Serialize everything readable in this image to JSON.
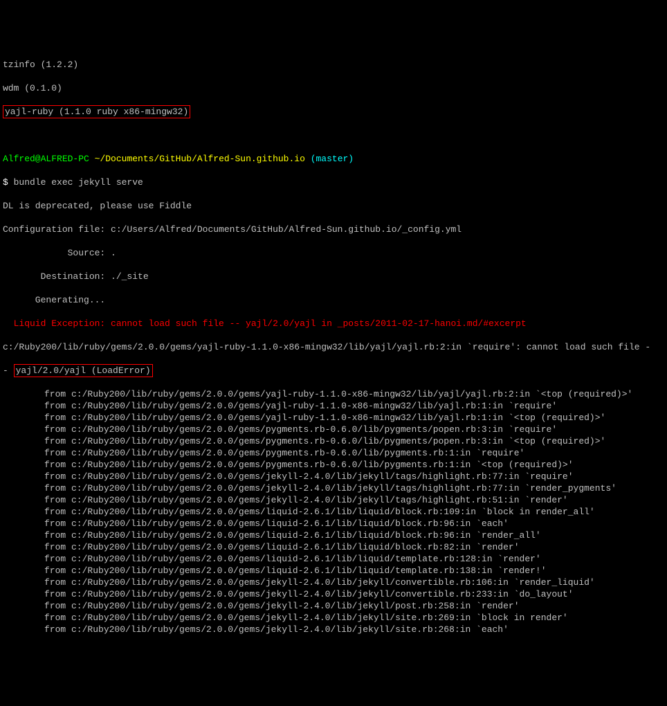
{
  "top": {
    "l1": "tzinfo (1.2.2)",
    "l2": "wdm (0.1.0)",
    "l3": "yajl-ruby (1.1.0 ruby x86-mingw32)"
  },
  "prompt": {
    "user_host": "Alfred@ALFRED-PC",
    "sep": " ",
    "path": "~/Documents/GitHub/Alfred-Sun.github.io",
    "branch": " (master)",
    "sym": "$ ",
    "cmd": "bundle exec jekyll serve"
  },
  "output": {
    "l1": "DL is deprecated, please use Fiddle",
    "l2": "Configuration file: c:/Users/Alfred/Documents/GitHub/Alfred-Sun.github.io/_config.yml",
    "l3": "            Source: .",
    "l4": "       Destination: ./_site",
    "l5": "      Generating..."
  },
  "err": {
    "l1": "  Liquid Exception: cannot load such file -- yajl/2.0/yajl in _posts/2011-02-17-hanoi.md/#excerpt",
    "l2a": "c:/Ruby200/lib/ruby/gems/2.0.0/gems/yajl-ruby-1.1.0-x86-mingw32/lib/yajl/yajl.rb:2:in `require': cannot load such file -",
    "l2b": "- ",
    "l2c": "yajl/2.0/yajl (LoadError)"
  },
  "trace": [
    "from c:/Ruby200/lib/ruby/gems/2.0.0/gems/yajl-ruby-1.1.0-x86-mingw32/lib/yajl/yajl.rb:2:in `<top (required)>'",
    "from c:/Ruby200/lib/ruby/gems/2.0.0/gems/yajl-ruby-1.1.0-x86-mingw32/lib/yajl.rb:1:in `require'",
    "from c:/Ruby200/lib/ruby/gems/2.0.0/gems/yajl-ruby-1.1.0-x86-mingw32/lib/yajl.rb:1:in `<top (required)>'",
    "from c:/Ruby200/lib/ruby/gems/2.0.0/gems/pygments.rb-0.6.0/lib/pygments/popen.rb:3:in `require'",
    "from c:/Ruby200/lib/ruby/gems/2.0.0/gems/pygments.rb-0.6.0/lib/pygments/popen.rb:3:in `<top (required)>'",
    "from c:/Ruby200/lib/ruby/gems/2.0.0/gems/pygments.rb-0.6.0/lib/pygments.rb:1:in `require'",
    "from c:/Ruby200/lib/ruby/gems/2.0.0/gems/pygments.rb-0.6.0/lib/pygments.rb:1:in `<top (required)>'",
    "from c:/Ruby200/lib/ruby/gems/2.0.0/gems/jekyll-2.4.0/lib/jekyll/tags/highlight.rb:77:in `require'",
    "from c:/Ruby200/lib/ruby/gems/2.0.0/gems/jekyll-2.4.0/lib/jekyll/tags/highlight.rb:77:in `render_pygments'",
    "from c:/Ruby200/lib/ruby/gems/2.0.0/gems/jekyll-2.4.0/lib/jekyll/tags/highlight.rb:51:in `render'",
    "from c:/Ruby200/lib/ruby/gems/2.0.0/gems/liquid-2.6.1/lib/liquid/block.rb:109:in `block in render_all'",
    "from c:/Ruby200/lib/ruby/gems/2.0.0/gems/liquid-2.6.1/lib/liquid/block.rb:96:in `each'",
    "from c:/Ruby200/lib/ruby/gems/2.0.0/gems/liquid-2.6.1/lib/liquid/block.rb:96:in `render_all'",
    "from c:/Ruby200/lib/ruby/gems/2.0.0/gems/liquid-2.6.1/lib/liquid/block.rb:82:in `render'",
    "from c:/Ruby200/lib/ruby/gems/2.0.0/gems/liquid-2.6.1/lib/liquid/template.rb:128:in `render'",
    "from c:/Ruby200/lib/ruby/gems/2.0.0/gems/liquid-2.6.1/lib/liquid/template.rb:138:in `render!'",
    "from c:/Ruby200/lib/ruby/gems/2.0.0/gems/jekyll-2.4.0/lib/jekyll/convertible.rb:106:in `render_liquid'",
    "from c:/Ruby200/lib/ruby/gems/2.0.0/gems/jekyll-2.4.0/lib/jekyll/convertible.rb:233:in `do_layout'",
    "from c:/Ruby200/lib/ruby/gems/2.0.0/gems/jekyll-2.4.0/lib/jekyll/post.rb:258:in `render'",
    "from c:/Ruby200/lib/ruby/gems/2.0.0/gems/jekyll-2.4.0/lib/jekyll/site.rb:269:in `block in render'",
    "from c:/Ruby200/lib/ruby/gems/2.0.0/gems/jekyll-2.4.0/lib/jekyll/site.rb:268:in `each'"
  ]
}
